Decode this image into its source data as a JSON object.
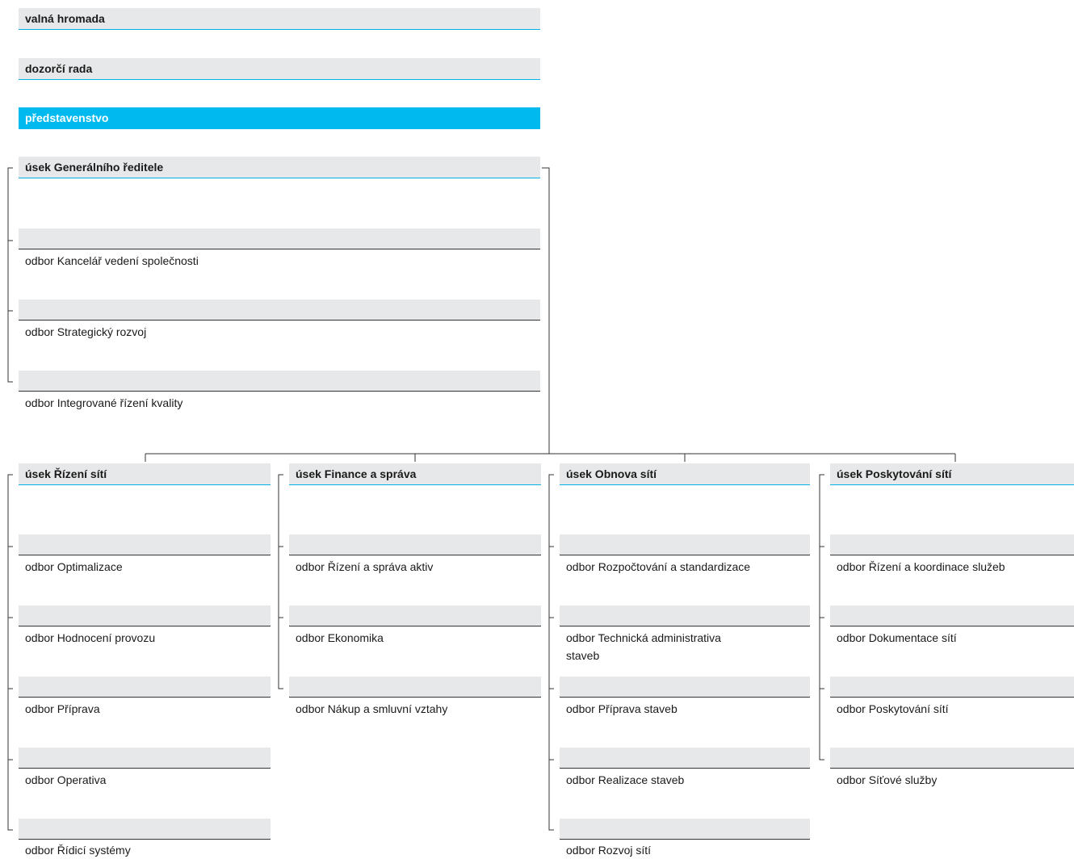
{
  "governance": {
    "general_meeting": "valná hromada",
    "supervisory_board": "dozorčí rada",
    "board_of_directors": "představenstvo"
  },
  "ceo_section": {
    "title": "úsek Generálního ředitele",
    "departments": [
      "odbor Kancelář vedení společnosti",
      "odbor Strategický rozvoj",
      "odbor Integrované řízení kvality"
    ]
  },
  "sections": [
    {
      "title": "úsek Řízení sítí",
      "departments": [
        "odbor Optimalizace",
        "odbor Hodnocení provozu",
        "odbor Příprava",
        "odbor Operativa",
        "odbor Řídicí systémy"
      ]
    },
    {
      "title": "úsek Finance a správa",
      "departments": [
        "odbor Řízení a správa aktiv",
        "odbor Ekonomika",
        "odbor Nákup a smluvní vztahy"
      ]
    },
    {
      "title": "úsek Obnova sítí",
      "departments": [
        "odbor Rozpočtování a standardizace",
        "odbor Technická administrativa staveb",
        "odbor Příprava staveb",
        "odbor Realizace staveb",
        "odbor Rozvoj sítí"
      ]
    },
    {
      "title": "úsek Poskytování sítí",
      "departments": [
        "odbor Řízení a koordinace služeb",
        "odbor Dokumentace sítí",
        "odbor Poskytování sítí",
        "odbor Síťové služby"
      ]
    }
  ],
  "colors": {
    "accent": "#00b9ef",
    "box_fill": "#e7e8e9",
    "line": "#333333"
  }
}
